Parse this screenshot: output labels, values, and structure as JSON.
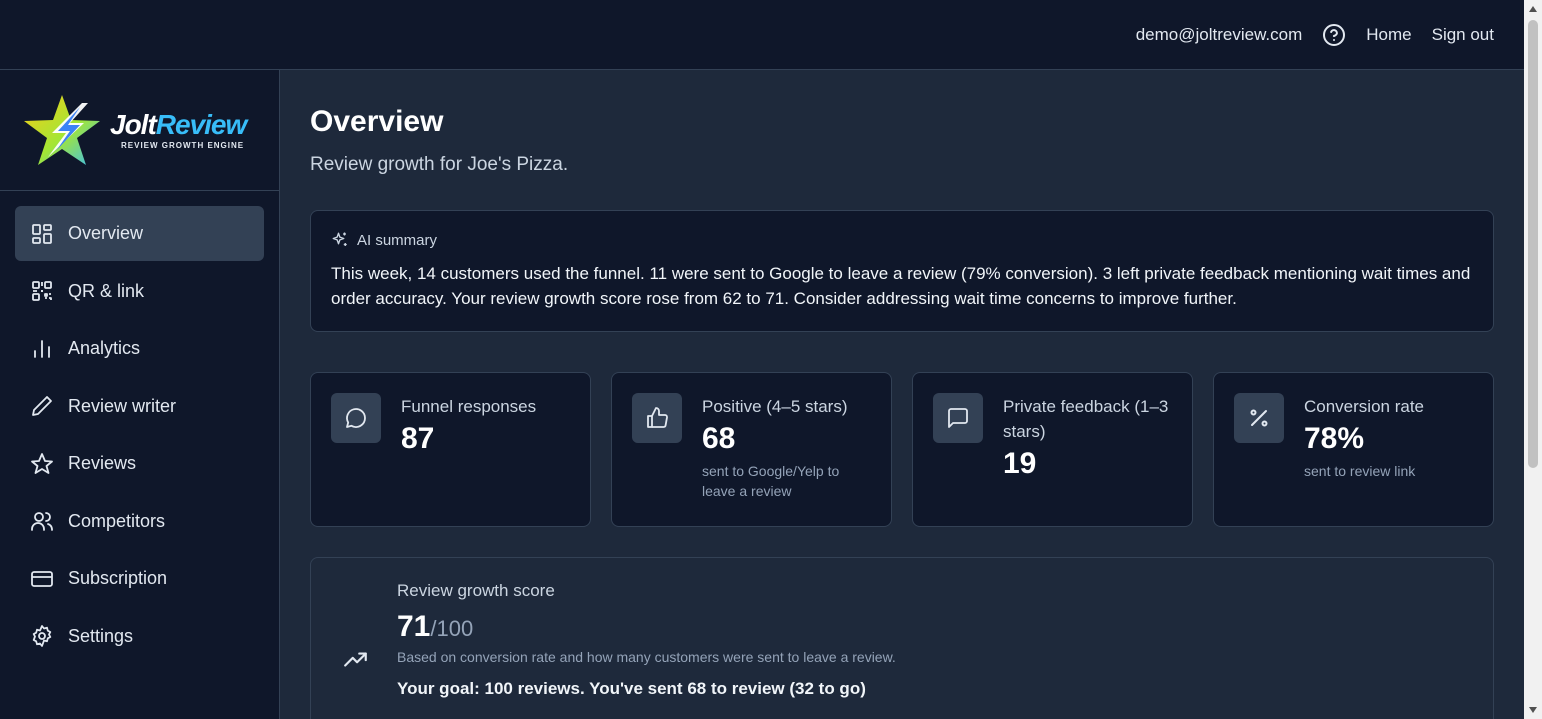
{
  "header": {
    "email": "demo@joltreview.com",
    "home_label": "Home",
    "signout_label": "Sign out"
  },
  "brand": {
    "name_part1": "Jolt",
    "name_part2": "Review",
    "tagline": "REVIEW GROWTH ENGINE"
  },
  "sidebar": {
    "items": [
      {
        "label": "Overview",
        "icon": "dashboard-icon",
        "active": true
      },
      {
        "label": "QR & link",
        "icon": "qr-code-icon",
        "active": false
      },
      {
        "label": "Analytics",
        "icon": "bar-chart-icon",
        "active": false
      },
      {
        "label": "Review writer",
        "icon": "pen-icon",
        "active": false
      },
      {
        "label": "Reviews",
        "icon": "star-icon",
        "active": false
      },
      {
        "label": "Competitors",
        "icon": "users-icon",
        "active": false
      },
      {
        "label": "Subscription",
        "icon": "credit-card-icon",
        "active": false
      },
      {
        "label": "Settings",
        "icon": "gear-icon",
        "active": false
      }
    ]
  },
  "main": {
    "title": "Overview",
    "subtitle": "Review growth for Joe's Pizza.",
    "ai_summary": {
      "heading": "AI summary",
      "text": "This week, 14 customers used the funnel. 11 were sent to Google to leave a review (79% conversion). 3 left private feedback mentioning wait times and order accuracy. Your review growth score rose from 62 to 71. Consider addressing wait time concerns to improve further."
    },
    "stats": [
      {
        "label": "Funnel responses",
        "value": "87",
        "note": "",
        "icon": "message-circle-icon"
      },
      {
        "label": "Positive (4–5 stars)",
        "value": "68",
        "note": "sent to Google/Yelp to leave a review",
        "icon": "thumbs-up-icon"
      },
      {
        "label": "Private feedback (1–3 stars)",
        "value": "19",
        "note": "",
        "icon": "message-square-icon"
      },
      {
        "label": "Conversion rate",
        "value": "78%",
        "note": "sent to review link",
        "icon": "percent-icon"
      }
    ],
    "growth": {
      "label": "Review growth score",
      "score": "71",
      "denominator": "/100",
      "note": "Based on conversion rate and how many customers were sent to leave a review.",
      "goal": "Your goal: 100 reviews. You've sent 68 to review (32 to go)"
    }
  },
  "colors": {
    "background": "#1e293b",
    "panel": "#0f172a",
    "border": "#334155",
    "accent": "#38bdf8"
  }
}
